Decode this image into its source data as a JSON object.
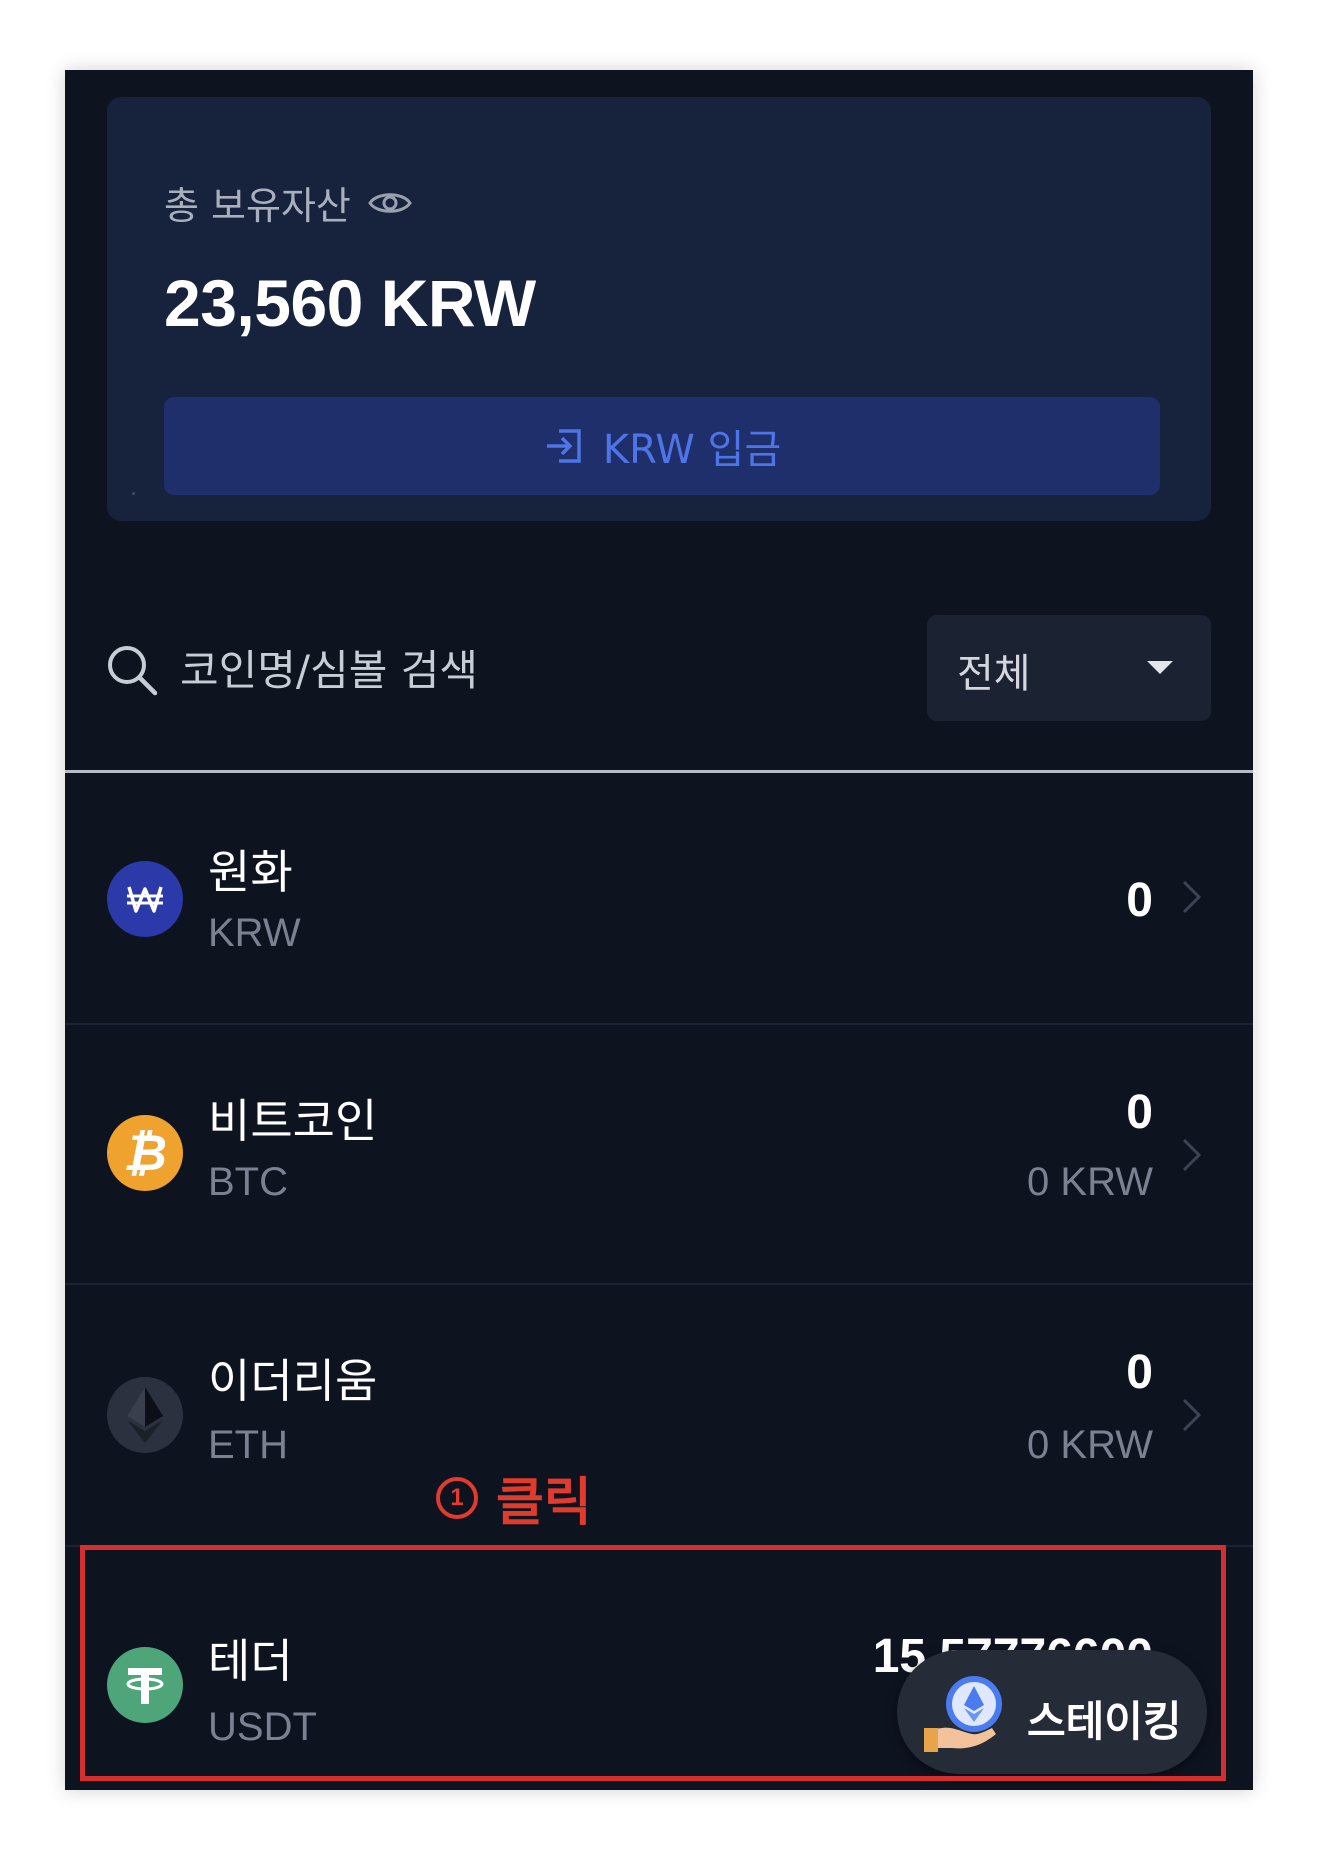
{
  "asset_summary": {
    "label": "총 보유자산",
    "total": "23,560 KRW",
    "deposit_button": "KRW 입금"
  },
  "search": {
    "placeholder": "코인명/심볼 검색",
    "filter_selected": "전체"
  },
  "coins": [
    {
      "name": "원화",
      "symbol": "KRW",
      "amount": "0",
      "krw_value": "",
      "icon": "won-icon",
      "color": "#2b3aa8"
    },
    {
      "name": "비트코인",
      "symbol": "BTC",
      "amount": "0",
      "krw_value": "0 KRW",
      "icon": "bitcoin-icon",
      "color": "#f0a22f"
    },
    {
      "name": "이더리움",
      "symbol": "ETH",
      "amount": "0",
      "krw_value": "0 KRW",
      "icon": "ethereum-icon",
      "color": "#2c3140"
    },
    {
      "name": "테더",
      "symbol": "USDT",
      "amount": "15.57776600",
      "krw_value": "",
      "icon": "tether-icon",
      "color": "#4fa57a"
    }
  ],
  "annotation": {
    "number": "1",
    "text": "클릭",
    "color": "#e23a2c"
  },
  "staking_button": {
    "label": "스테이킹"
  }
}
